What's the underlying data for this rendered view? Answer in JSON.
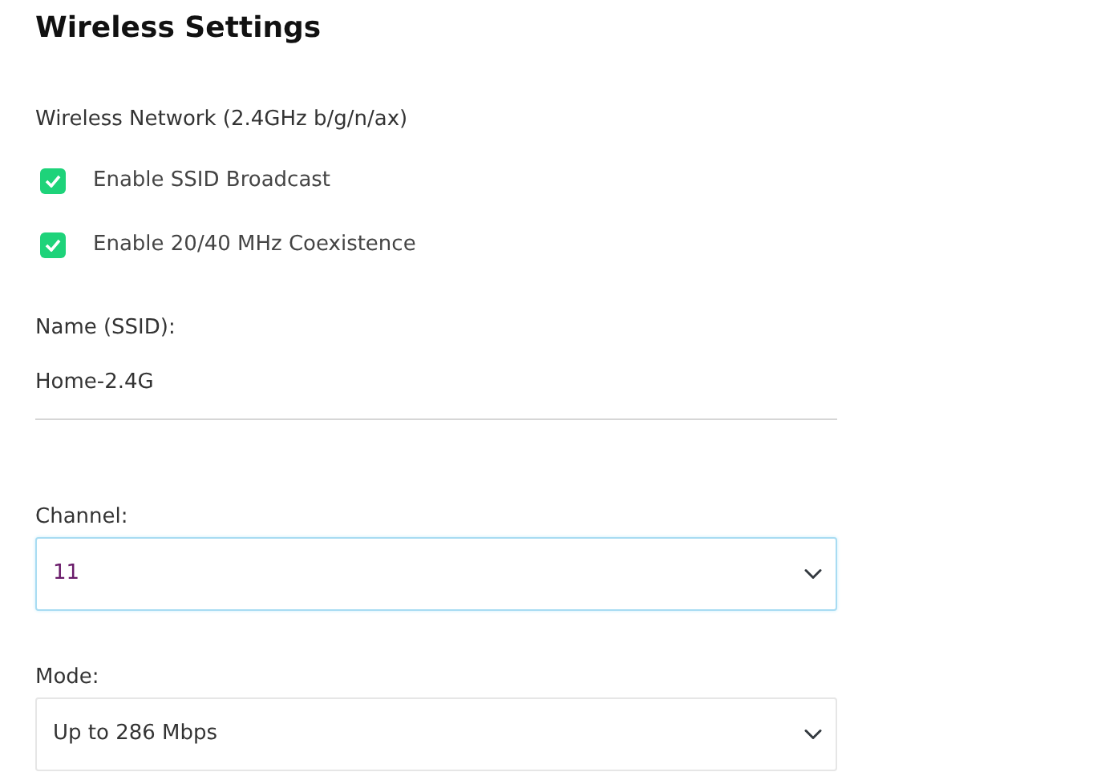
{
  "title": "Wireless Settings",
  "section": "Wireless Network (2.4GHz b/g/n/ax)",
  "options": [
    {
      "label": "Enable SSID Broadcast",
      "checked": true
    },
    {
      "label": "Enable 20/40 MHz Coexistence",
      "checked": true
    }
  ],
  "name_field": {
    "label": "Name (SSID):",
    "value": "Home-2.4G"
  },
  "selects": [
    {
      "label": "Channel:",
      "value": "11",
      "focused": true
    },
    {
      "label": "Mode:",
      "value": "Up to 286 Mbps",
      "focused": false
    }
  ]
}
